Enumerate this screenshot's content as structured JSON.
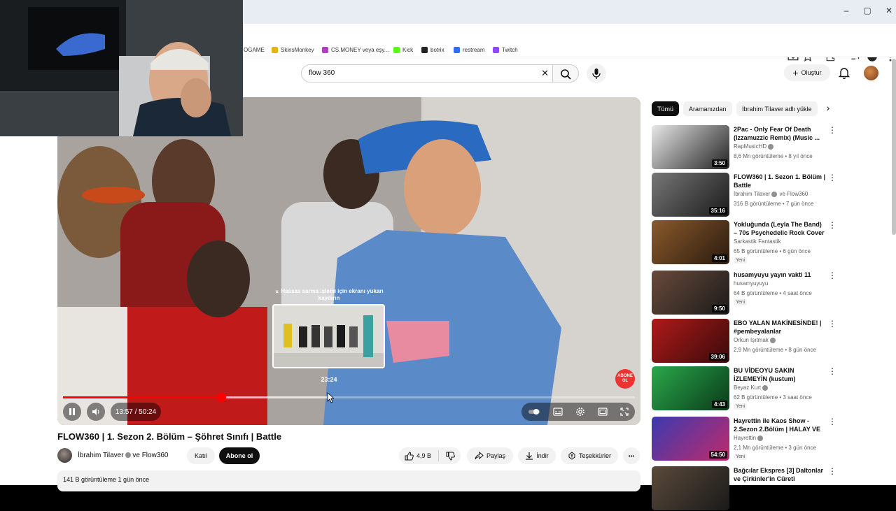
{
  "browser": {
    "window_controls": {
      "minimize": "–",
      "maximize": "▢",
      "close": "✕"
    },
    "bookmarks": [
      {
        "label": "OGAME",
        "color": "#ffffff"
      },
      {
        "label": "SkinsMonkey",
        "color": "#e7b416"
      },
      {
        "label": "CS.MONEY veya eşy...",
        "color": "#b040c0"
      },
      {
        "label": "Kick",
        "color": "#53fc18"
      },
      {
        "label": "botrix",
        "color": "#222222"
      },
      {
        "label": "restream",
        "color": "#2b6ef2"
      },
      {
        "label": "Twitch",
        "color": "#9146ff"
      }
    ]
  },
  "header": {
    "search_value": "flow 360",
    "create_label": "Oluştur"
  },
  "player": {
    "preview_hint": "⌅ Hassas sarma işlemi için ekranı yukarı kaydırın",
    "preview_time": "23:24",
    "time_display": "13:57 / 50:24",
    "progress_fraction": 0.277,
    "buffer_fraction": 0.465,
    "hover_fraction": 0.466,
    "badge_text": "ABONE OL"
  },
  "video": {
    "title": "FLOW360 | 1. Sezon 2. Bölüm – Şöhret Sınıfı | Battle",
    "channel": "İbrahim Tilaver",
    "channel_suffix": "ve Flow360",
    "join_label": "Katıl",
    "subscribe_label": "Abone ol",
    "like_count": "4,9 B",
    "share_label": "Paylaş",
    "download_label": "İndir",
    "thanks_label": "Teşekkürler",
    "more_label": "•••",
    "meta": "141 B görüntüleme  1 gün önce"
  },
  "sidebar": {
    "chips": [
      "Tümü",
      "Aramanızdan",
      "İbrahim Tilaver adlı yükle"
    ],
    "recommendations": [
      {
        "title": "2Pac - Only Fear Of Death (Izzamuzzic Remix) (Music ...",
        "channel": "RapMusicHD",
        "verified": true,
        "stats": "8,6 Mn görüntüleme • 8 yıl önce",
        "duration": "3:50",
        "new": "",
        "colors": [
          "#e8e8e8",
          "#222"
        ]
      },
      {
        "title": "FLOW360 | 1. Sezon 1. Bölüm | Battle",
        "channel": "İbrahim Tilaver",
        "channel_suffix": "ve Flow360",
        "verified": true,
        "stats": "316 B görüntüleme • 7 gün önce",
        "duration": "35:16",
        "new": "",
        "colors": [
          "#777",
          "#1a1a1a"
        ]
      },
      {
        "title": "Yokluğunda (Leyla The Band) – 70s Psychedelic Rock Cover",
        "channel": "Sarkastik Fantastik",
        "verified": false,
        "stats": "65 B görüntüleme • 6 gün önce",
        "duration": "4:01",
        "new": "Yeni",
        "colors": [
          "#8a5a2a",
          "#2a1a10"
        ]
      },
      {
        "title": "husamyuyu yayın vakti 11",
        "channel": "husamyuyuyu",
        "verified": false,
        "stats": "64 B görüntüleme • 4 saat önce",
        "duration": "9:50",
        "new": "Yeni",
        "colors": [
          "#6a4a3a",
          "#1a1a1a"
        ]
      },
      {
        "title": "EBO YALAN MAKİNESİNDE! | #pembeyalanlar",
        "channel": "Orkun Işıtmak",
        "verified": true,
        "stats": "2,9 Mn görüntüleme • 8 gün önce",
        "duration": "39:06",
        "new": "",
        "colors": [
          "#b01a1a",
          "#3a0a0a"
        ]
      },
      {
        "title": "BU VİDEOYU SAKIN İZLEMEYİN (kustum)",
        "channel": "Beyaz Kurt",
        "verified": true,
        "stats": "62 B görüntüleme • 3 saat önce",
        "duration": "4:43",
        "new": "Yeni",
        "colors": [
          "#2aa84a",
          "#0a3a1a"
        ]
      },
      {
        "title": "Hayrettin ile Kaos Show - 2.Sezon 2.Bölüm | HALAY VE ...",
        "channel": "Hayrettin",
        "verified": true,
        "stats": "2,1 Mn görüntüleme • 3 gün önce",
        "duration": "54:50",
        "new": "Yeni",
        "colors": [
          "#3a3ab0",
          "#c02a6a"
        ]
      },
      {
        "title": "Bağcılar Ekspres [3] Daltonlar ve Çirkinler'in Cüreti",
        "channel": "",
        "verified": false,
        "stats": "",
        "duration": "",
        "new": "",
        "colors": [
          "#5a4a3a",
          "#1a1a1a"
        ]
      }
    ]
  }
}
